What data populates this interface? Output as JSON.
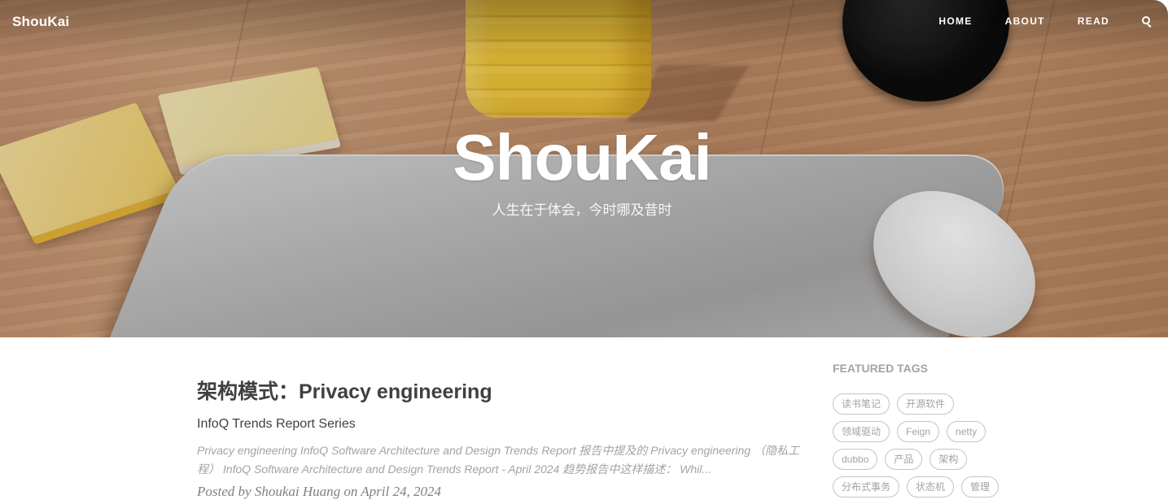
{
  "navbar": {
    "brand": "ShouKai",
    "links": [
      "HOME",
      "ABOUT",
      "READ"
    ]
  },
  "hero": {
    "title": "ShouKai",
    "subtitle": "人生在于体会，今时哪及昔时"
  },
  "post": {
    "title": "架构模式：Privacy engineering",
    "subtitle": "InfoQ Trends Report Series",
    "excerpt": "Privacy engineering InfoQ Software Architecture and Design Trends Report 报告中提及的 Privacy engineering （隐私工程） InfoQ Software Architecture and Design Trends Report - April 2024 趋势报告中这样描述： Whil...",
    "meta": "Posted by Shoukai Huang on April 24, 2024"
  },
  "sidebar": {
    "title": "FEATURED TAGS",
    "tags": [
      "读书笔记",
      "开源软件",
      "领域驱动",
      "Feign",
      "netty",
      "dubbo",
      "产品",
      "架构",
      "分布式事务",
      "状态机",
      "管理"
    ]
  },
  "colors": {
    "text": "#404040",
    "muted": "#a3a3a3",
    "meta": "#808080",
    "tag_border": "#c4c4c4"
  },
  "icons": {
    "search": "search-icon"
  }
}
